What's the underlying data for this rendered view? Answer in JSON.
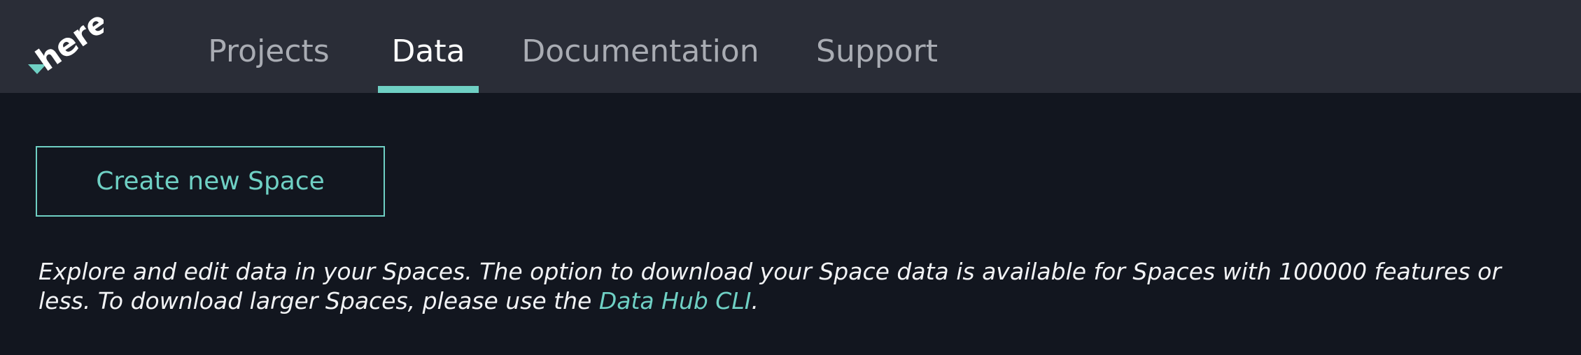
{
  "app": {
    "logo_text": "here",
    "accent_color": "#6fd0c4"
  },
  "nav": {
    "tabs": [
      {
        "label": "Projects",
        "active": false
      },
      {
        "label": "Data",
        "active": true
      },
      {
        "label": "Documentation",
        "active": false
      },
      {
        "label": "Support",
        "active": false
      }
    ]
  },
  "main": {
    "create_button_label": "Create new Space",
    "description_text": "Explore and edit data in your Spaces. The option to download your Space data is available for Spaces with 100000 features or less. To download larger Spaces, please use the ",
    "description_link": "Data Hub CLI",
    "description_end": "."
  }
}
